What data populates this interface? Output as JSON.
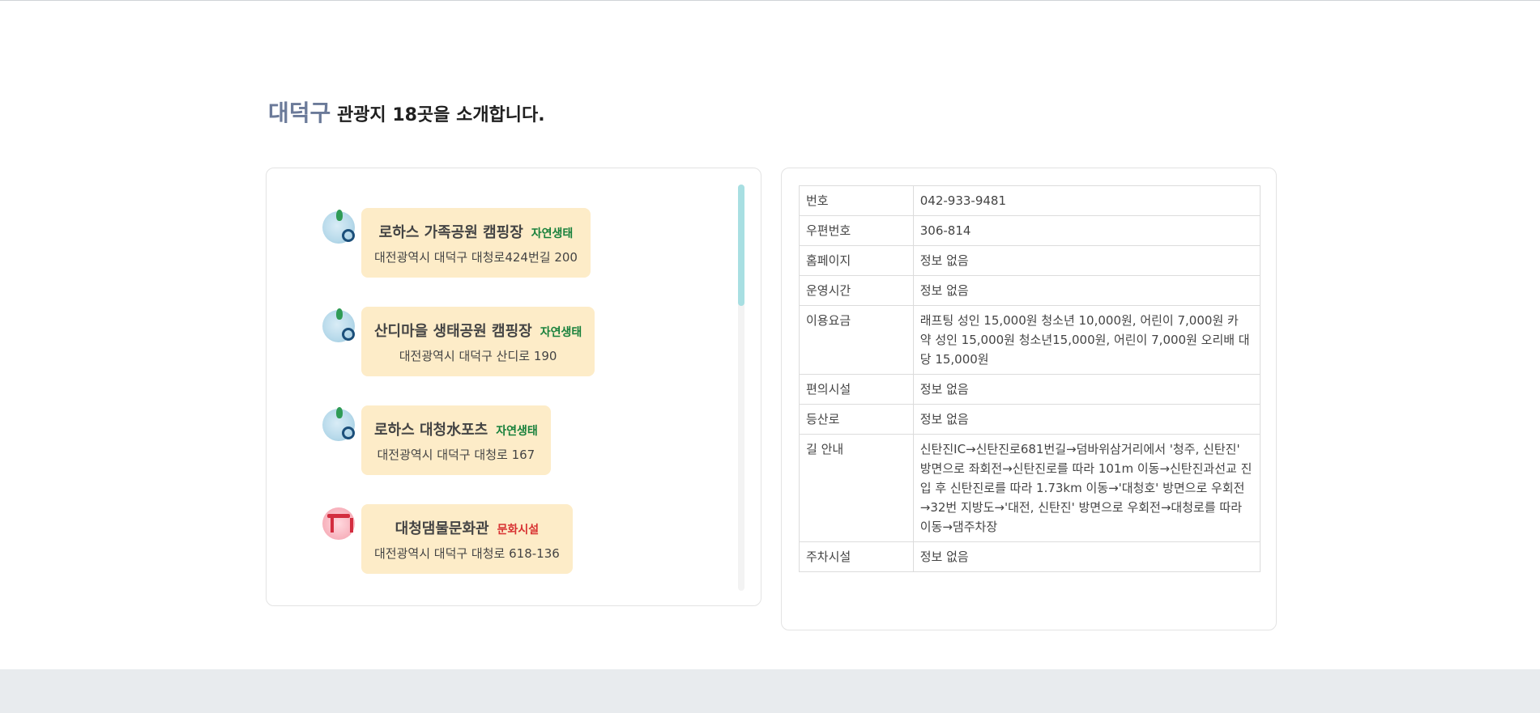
{
  "header": {
    "district": "대덕구",
    "title_rest": " 관광지 18곳을 소개합니다."
  },
  "places": [
    {
      "name": "로하스 가족공원 캠핑장",
      "category": "자연생태",
      "address": "대전광역시 대덕구 대청로424번길 200",
      "icon": "nature-search-icon"
    },
    {
      "name": "산디마을 생태공원 캠핑장",
      "category": "자연생태",
      "address": "대전광역시 대덕구 산디로 190",
      "icon": "nature-search-icon"
    },
    {
      "name": "로하스 대청水포츠",
      "category": "자연생태",
      "address": "대전광역시 대덕구 대청로 167",
      "icon": "nature-search-icon"
    },
    {
      "name": "대청댐물문화관",
      "category": "문화시설",
      "address": "대전광역시 대덕구 대청로 618-136",
      "icon": "culture-gate-icon"
    }
  ],
  "details": [
    {
      "label": "번호",
      "value": "042-933-9481"
    },
    {
      "label": "우편번호",
      "value": "306-814"
    },
    {
      "label": "홈페이지",
      "value": "정보 없음"
    },
    {
      "label": "운영시간",
      "value": "정보 없음"
    },
    {
      "label": "이용요금",
      "value": "래프팅 성인 15,000원 청소년 10,000원, 어린이 7,000원 카 약 성인 15,000원 청소년15,000원, 어린이 7,000원 오리배 대당 15,000원"
    },
    {
      "label": "편의시설",
      "value": "정보 없음"
    },
    {
      "label": "등산로",
      "value": "정보 없음"
    },
    {
      "label": "길 안내",
      "value": "신탄진IC→신탄진로681번길→덤바위삼거리에서 '청주, 신탄진' 방면으로 좌회전→신탄진로를 따라 101m 이동→신탄진과선교 진입 후 신탄진로를 따라 1.73km 이동→'대청호' 방면으로 우회전→32번 지방도→'대전, 신탄진' 방면으로 우회전→대청로를 따라 이동→댐주차장"
    },
    {
      "label": "주차시설",
      "value": "정보 없음"
    }
  ],
  "colors": {
    "district": "#6b7a99",
    "card_bg": "#fdecc8",
    "nature_category": "#17803b",
    "culture_category": "#d83232",
    "scroll_thumb": "#a8dfe2"
  }
}
